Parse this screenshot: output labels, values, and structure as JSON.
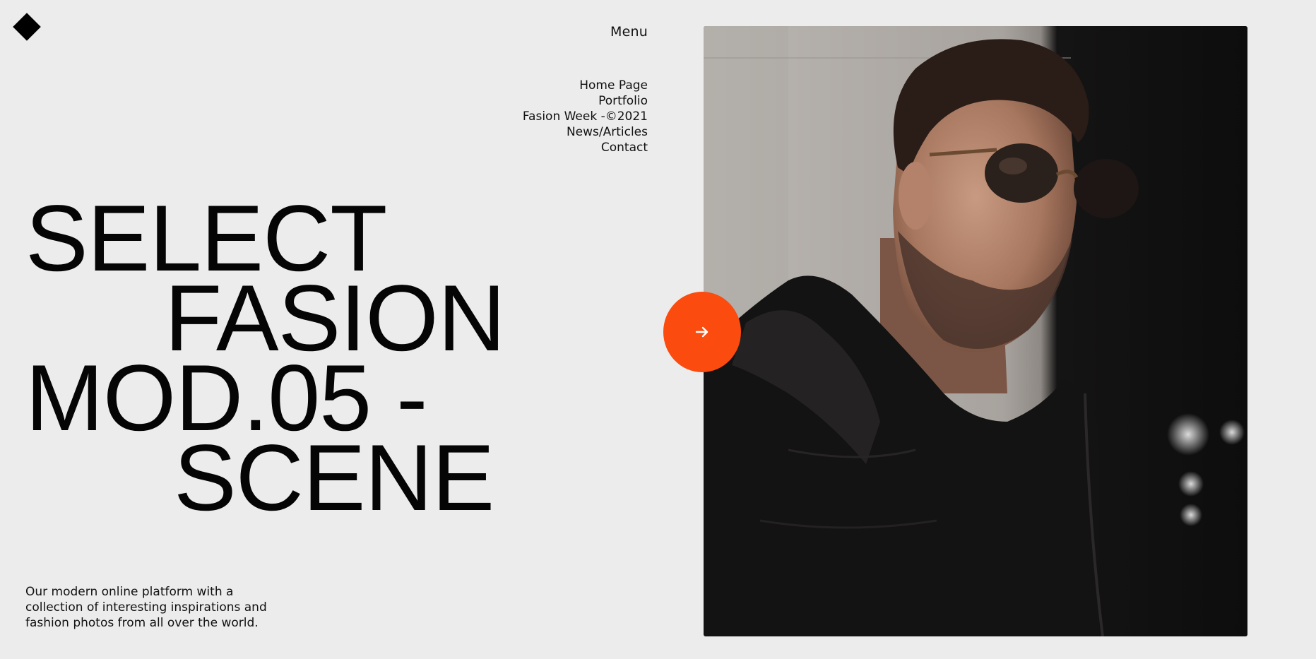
{
  "nav": {
    "menu_label": "Menu",
    "items": [
      {
        "label": "Home Page"
      },
      {
        "label": "Portfolio"
      },
      {
        "label": "Fasion Week -©2021"
      },
      {
        "label": "News/Articles"
      },
      {
        "label": "Contact"
      }
    ]
  },
  "hero": {
    "lines": [
      "SELECT",
      "FASION",
      "MOD.05 -",
      "SCENE"
    ]
  },
  "tagline": "Our modern online platform with a collection of interesting inspirations and fashion photos from all over the world.",
  "colors": {
    "background": "#ececec",
    "accent": "#fb4b0e",
    "text": "#111111"
  },
  "icons": {
    "logo": "diamond-logo-icon",
    "next": "arrow-right-icon"
  }
}
